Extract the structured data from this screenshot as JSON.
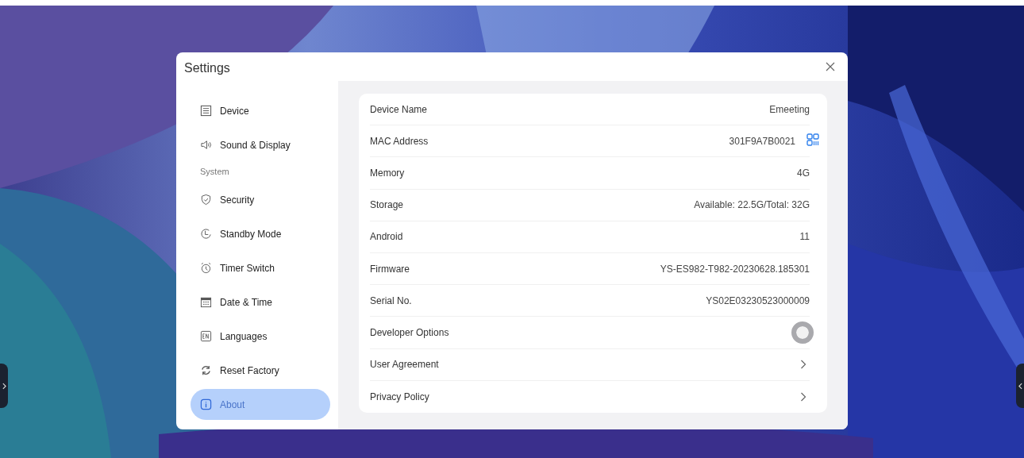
{
  "window": {
    "title": "Settings"
  },
  "sidebar": {
    "items": [
      {
        "kind": "item",
        "label": "Device",
        "selected": false
      },
      {
        "kind": "item",
        "label": "Sound & Display",
        "selected": false
      },
      {
        "kind": "header",
        "label": "System"
      },
      {
        "kind": "item",
        "label": "Security",
        "selected": false
      },
      {
        "kind": "item",
        "label": "Standby Mode",
        "selected": false
      },
      {
        "kind": "item",
        "label": "Timer Switch",
        "selected": false
      },
      {
        "kind": "item",
        "label": "Date & Time",
        "selected": false
      },
      {
        "kind": "item",
        "label": "Languages",
        "selected": false
      },
      {
        "kind": "item",
        "label": "Reset Factory",
        "selected": false
      },
      {
        "kind": "item",
        "label": "About",
        "selected": true
      }
    ]
  },
  "rows": [
    {
      "kind": "value",
      "label": "Device Name",
      "value": "Emeeting"
    },
    {
      "kind": "qr",
      "label": "MAC Address",
      "value": "301F9A7B0021"
    },
    {
      "kind": "value",
      "label": "Memory",
      "value": "4G"
    },
    {
      "kind": "value",
      "label": "Storage",
      "value": "Available: 22.5G/Total: 32G"
    },
    {
      "kind": "value",
      "label": "Android",
      "value": "11"
    },
    {
      "kind": "value",
      "label": "Firmware",
      "value": "YS-ES982-T982-20230628.185301"
    },
    {
      "kind": "value",
      "label": "Serial No.",
      "value": "YS02E03230523000009"
    },
    {
      "kind": "switch",
      "label": "Developer Options",
      "on": false
    },
    {
      "kind": "link",
      "label": "User Agreement"
    },
    {
      "kind": "link",
      "label": "Privacy Policy"
    }
  ]
}
